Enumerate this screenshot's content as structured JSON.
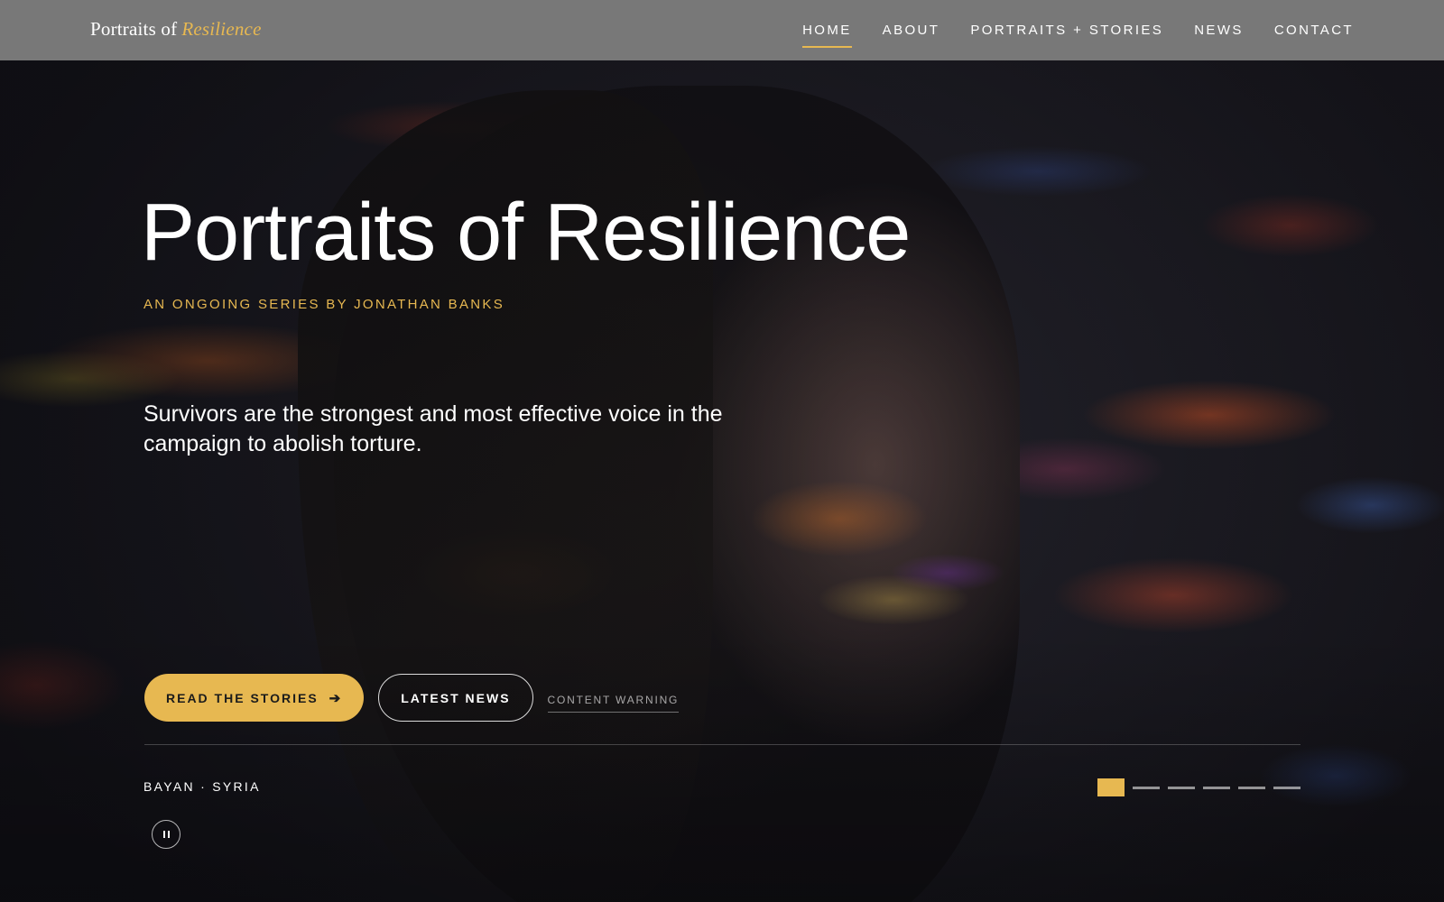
{
  "brand": {
    "prefix": "Portraits of",
    "accent": "Resilience"
  },
  "nav": {
    "items": [
      {
        "label": "HOME",
        "active": true
      },
      {
        "label": "ABOUT",
        "active": false
      },
      {
        "label": "PORTRAITS + STORIES",
        "active": false
      },
      {
        "label": "NEWS",
        "active": false
      },
      {
        "label": "CONTACT",
        "active": false
      }
    ]
  },
  "hero": {
    "title": "Portraits of Resilience",
    "subtitle": "AN ONGOING SERIES BY JONATHAN BANKS",
    "tagline": "Survivors are the strongest and most effective voice in the campaign to abolish torture.",
    "primary_cta": "READ THE STORIES",
    "primary_cta_icon": "arrow-right-icon",
    "secondary_cta": "LATEST NEWS",
    "warning_link": "CONTENT WARNING",
    "caption": "BAYAN · SYRIA",
    "slides": {
      "count": 6,
      "active_index": 0
    },
    "pause_icon": "pause-icon"
  },
  "colors": {
    "accent": "#e7b851",
    "topbar": "#7a7a7a",
    "text": "#ffffff"
  }
}
